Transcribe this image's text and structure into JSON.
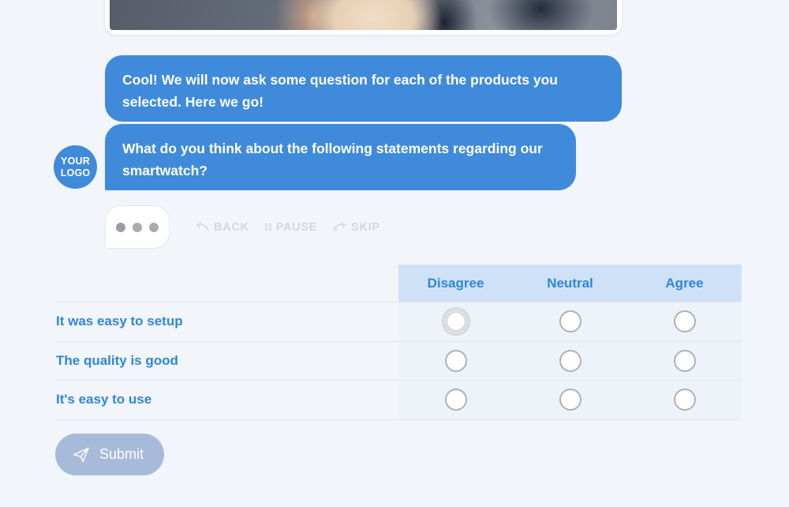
{
  "theme": {
    "background": "#f2f5fa",
    "brand_blue": "#3f8ada",
    "header_band": "#cfe1f6",
    "link_blue": "#2f86d8",
    "submit_bg": "#a8bada",
    "control_gray": "#d3d8e0"
  },
  "media_card": {
    "name": "product-photo"
  },
  "chat": {
    "avatar": {
      "line1": "YOUR",
      "line2": "LOGO"
    },
    "messages": [
      {
        "text": "Cool! We will now ask some question for each of the products you selected. Here we go!"
      },
      {
        "text": "What do you think about the following statements regarding our smartwatch?"
      }
    ],
    "typing_indicator": {
      "dots": 3
    }
  },
  "controls": [
    {
      "label": "BACK",
      "icon": "back-arrow-icon"
    },
    {
      "label": "PAUSE",
      "icon": "pause-icon"
    },
    {
      "label": "SKIP",
      "icon": "skip-arrow-icon"
    }
  ],
  "matrix": {
    "columns": [
      "Disagree",
      "Neutral",
      "Agree"
    ],
    "rows": [
      {
        "label": "It was easy to setup",
        "selected": null,
        "hovered_column": 0
      },
      {
        "label": "The quality is good",
        "selected": null,
        "hovered_column": null
      },
      {
        "label": "It's easy to use",
        "selected": null,
        "hovered_column": null
      }
    ]
  },
  "submit": {
    "label": "Submit",
    "icon": "send-icon",
    "enabled": false
  }
}
